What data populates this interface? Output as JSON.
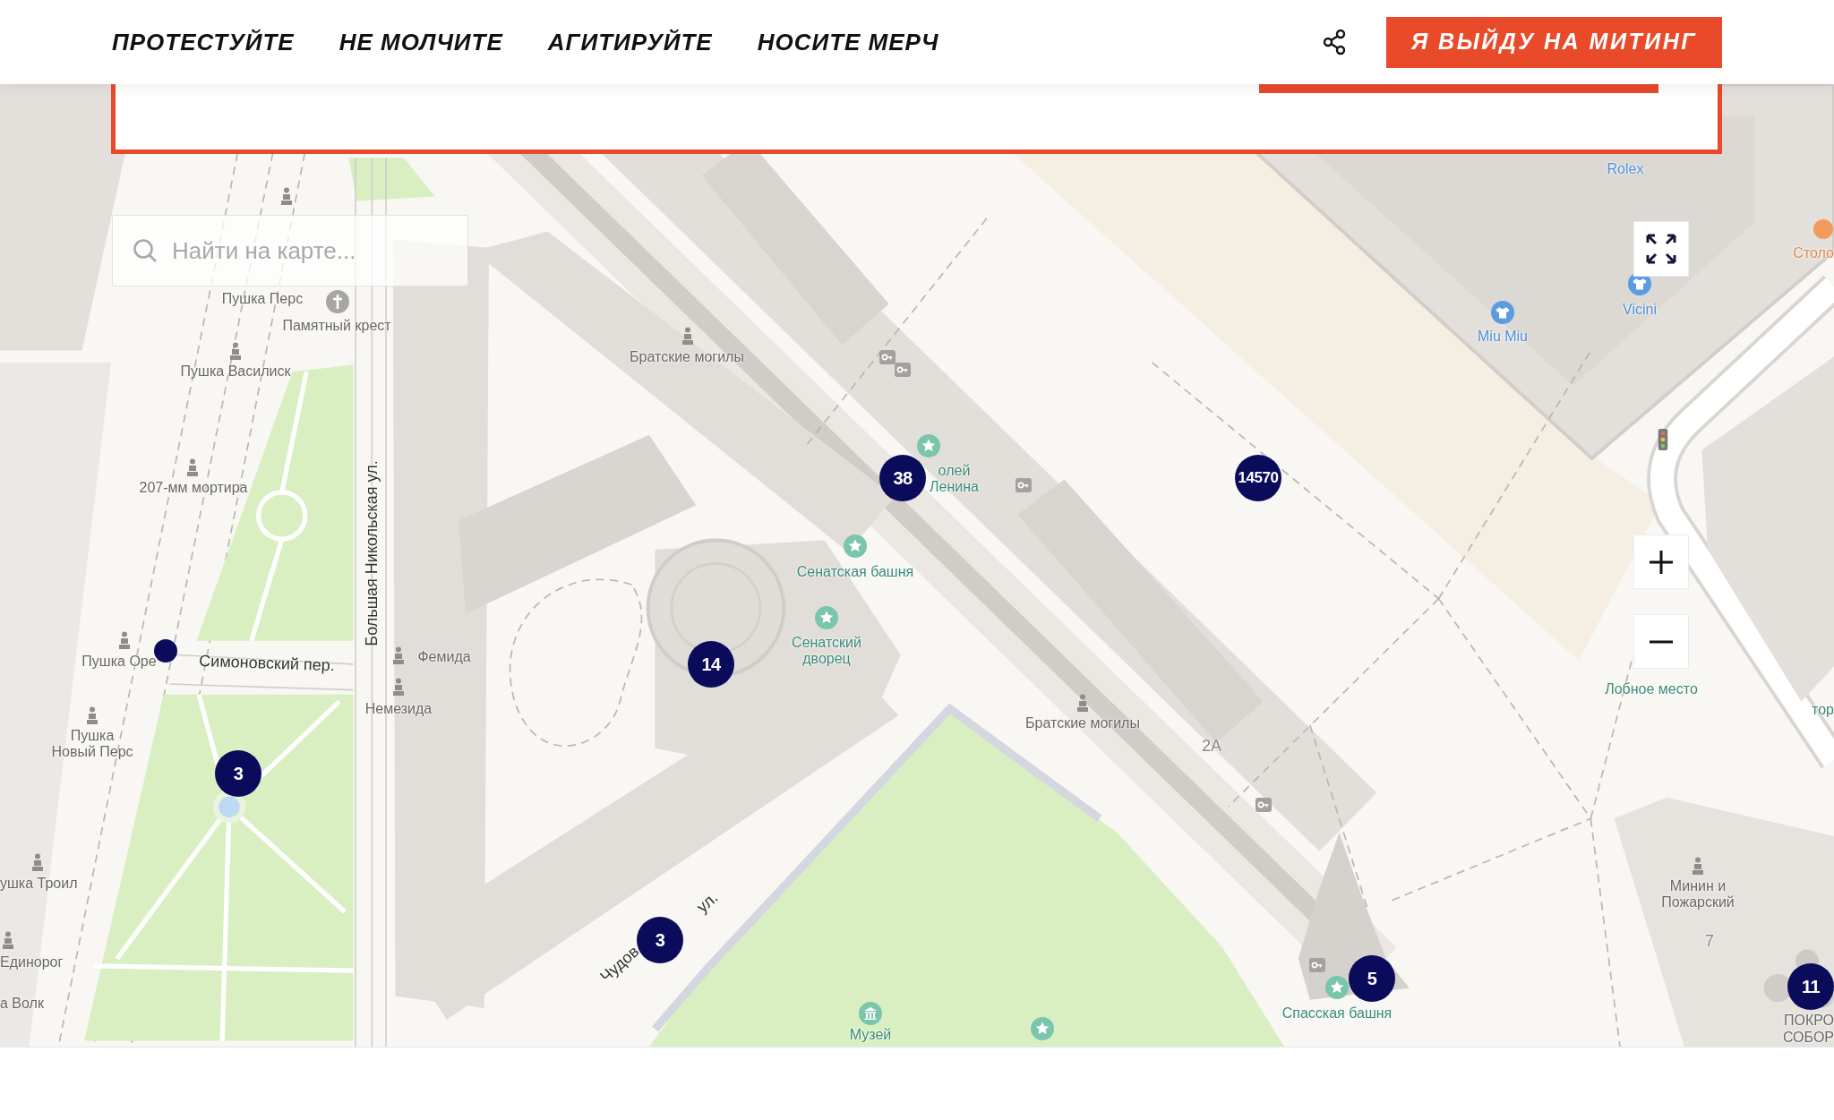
{
  "header": {
    "nav_links": [
      "ПРОТЕСТУЙТЕ",
      "НЕ МОЛЧИТЕ",
      "АГИТИРУЙТЕ",
      "НОСИТЕ МЕРЧ"
    ],
    "cta_button": "Я ВЫЙДУ НА МИТИНГ"
  },
  "map": {
    "search": {
      "placeholder": "Найти на карте..."
    },
    "labels": [
      {
        "kind": "shop",
        "lines": [
          "Rolex"
        ]
      },
      {
        "kind": "cafe",
        "lines": [
          "Столо"
        ]
      },
      {
        "kind": "landmark",
        "lines": [
          "Пушка Перс"
        ]
      },
      {
        "kind": "shop",
        "lines": [
          "Vicini"
        ]
      },
      {
        "kind": "landmark",
        "lines": [
          "Памятный крест"
        ]
      },
      {
        "kind": "shop",
        "lines": [
          "Miu Miu"
        ]
      },
      {
        "kind": "landmark",
        "lines": [
          "Братские могилы"
        ]
      },
      {
        "kind": "landmark",
        "lines": [
          "Пушка Василиск"
        ]
      },
      {
        "kind": "landmark",
        "lines": [
          "207-мм мортира"
        ]
      },
      {
        "kind": "attraction",
        "lines": [
          "олей",
          "Ленина"
        ]
      },
      {
        "kind": "street",
        "lines": [
          "Большая Никольская ул."
        ]
      },
      {
        "kind": "attraction",
        "lines": [
          "Сенатская башня"
        ]
      },
      {
        "kind": "landmark",
        "lines": [
          "Пушка Оре"
        ]
      },
      {
        "kind": "street",
        "lines": [
          "Симоновский пер."
        ]
      },
      {
        "kind": "landmark",
        "lines": [
          "Фемида"
        ]
      },
      {
        "kind": "attraction",
        "lines": [
          "Сенатский",
          "дворец"
        ]
      },
      {
        "kind": "attraction",
        "lines": [
          "Лобное место"
        ]
      },
      {
        "kind": "landmark",
        "lines": [
          "Немезида"
        ]
      },
      {
        "kind": "landmark",
        "lines": [
          "Братские могилы"
        ]
      },
      {
        "kind": "attraction",
        "lines": [
          "тор"
        ]
      },
      {
        "kind": "landmark",
        "lines": [
          "Пушка",
          "Новый Перс"
        ]
      },
      {
        "kind": "number",
        "lines": [
          "2А"
        ]
      },
      {
        "kind": "landmark",
        "lines": [
          "ушка Троил"
        ]
      },
      {
        "kind": "street",
        "lines": [
          "ул."
        ]
      },
      {
        "kind": "landmark",
        "lines": [
          "Минин и",
          "Пожарский"
        ]
      },
      {
        "kind": "number",
        "lines": [
          "7"
        ]
      },
      {
        "kind": "landmark",
        "lines": [
          "Единорог"
        ]
      },
      {
        "kind": "street",
        "lines": [
          "Чудов"
        ]
      },
      {
        "kind": "landmark",
        "lines": [
          "а Волк"
        ]
      },
      {
        "kind": "attraction",
        "lines": [
          "Спасская башня"
        ]
      },
      {
        "kind": "attraction",
        "lines": [
          "Музей"
        ]
      },
      {
        "kind": "landmark",
        "lines": [
          "ПОКРО",
          "СОБОР"
        ]
      }
    ],
    "clusters": [
      {
        "count": "38"
      },
      {
        "count": "14570"
      },
      {
        "count": "14"
      },
      {
        "count": "3"
      },
      {
        "count": "3"
      },
      {
        "count": "5"
      },
      {
        "count": "11"
      }
    ]
  }
}
